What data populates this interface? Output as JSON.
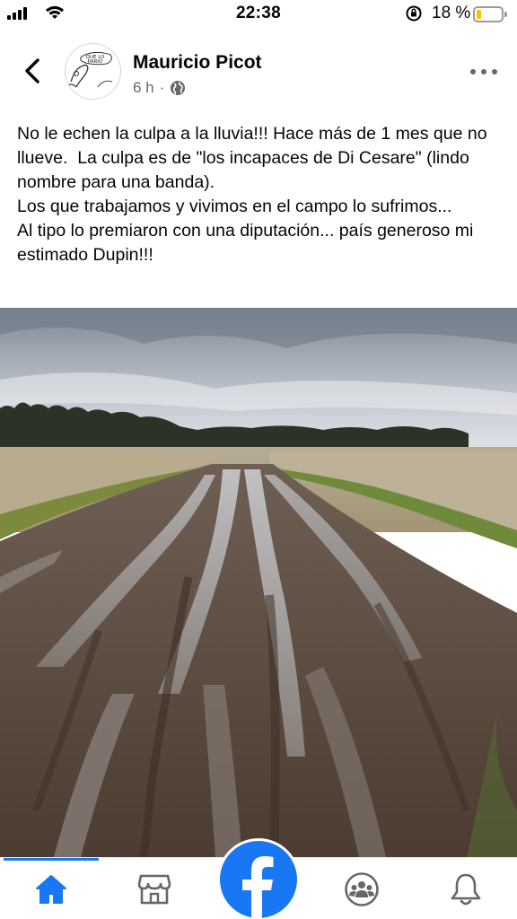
{
  "status_bar": {
    "time": "22:38",
    "battery_percent": "18 %",
    "battery_level": 0.18,
    "icons": [
      "signal-bars-icon",
      "wifi-icon",
      "orientation-lock-icon",
      "battery-icon"
    ]
  },
  "post": {
    "author": "Mauricio Picot",
    "avatar_text": [
      "QUE LO",
      "PARIO"
    ],
    "time_ago": "6 h",
    "separator": "·",
    "audience_icon": "globe-icon",
    "text_lines": [
      "No le echen la culpa a la lluvia!!! Hace más de 1 mes que no llueve.  La culpa es de \"los incapaces de Di Cesare\" (lindo nombre para una banda).",
      "Los que trabajamos y vivimos en el campo lo sufrimos...",
      "Al tipo lo premiaron con una diputación... país generoso mi estimado Dupin!!!"
    ],
    "photo": "muddy-dirt-road-photo"
  },
  "header": {
    "back_icon": "chevron-left-icon",
    "more_icon": "more-horizontal-icon"
  },
  "bottom_nav": {
    "items": [
      {
        "name": "home",
        "icon": "home-icon",
        "active": true
      },
      {
        "name": "marketplace",
        "icon": "marketplace-store-icon",
        "active": false
      },
      {
        "name": "facebook",
        "icon": "facebook-logo-icon",
        "active": false
      },
      {
        "name": "groups",
        "icon": "groups-icon",
        "active": false
      },
      {
        "name": "notifications",
        "icon": "bell-icon",
        "active": false
      }
    ],
    "accent": "#1877f2"
  },
  "colors": {
    "accent": "#1877f2",
    "text": "#050505",
    "secondary_text": "#65676b",
    "battery_low": "#f5c400"
  }
}
